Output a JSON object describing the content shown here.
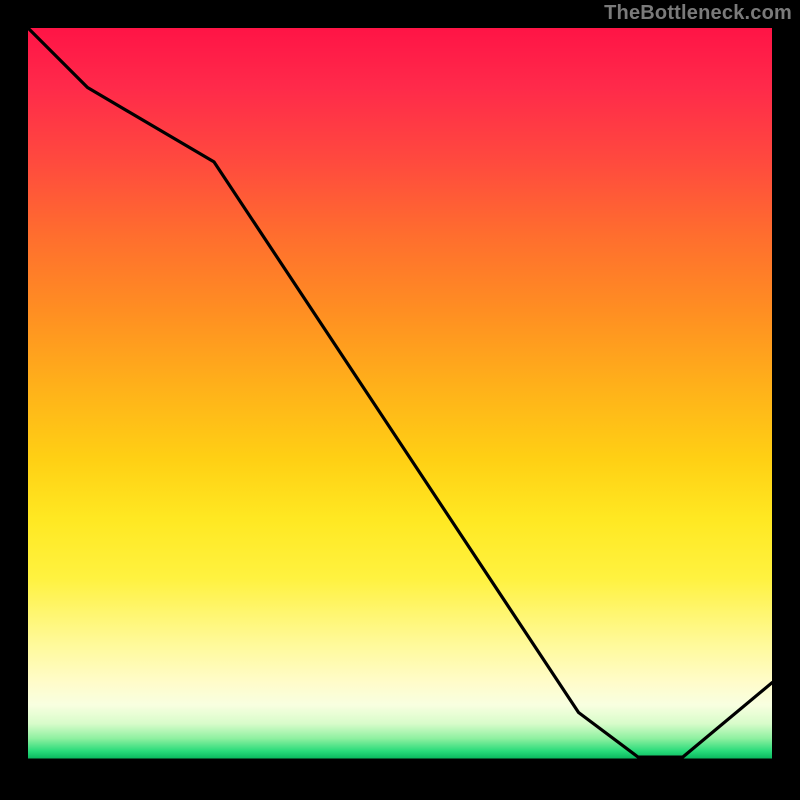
{
  "attribution": "TheBottleneck.com",
  "chart_data": {
    "type": "line",
    "title": "",
    "xlabel": "",
    "ylabel": "",
    "xlim": [
      0,
      100
    ],
    "ylim": [
      0,
      100
    ],
    "x": [
      0,
      8,
      25,
      74,
      82,
      88,
      100
    ],
    "values": [
      100,
      92,
      82,
      8,
      2,
      2,
      12
    ],
    "notes": "Black curve plotted over vertical red-to-green gradient; minimum plateau near x≈82–88 at y≈2.",
    "gradient_stops": [
      {
        "pos": 0.0,
        "color": "#ff1446"
      },
      {
        "pos": 0.38,
        "color": "#ff8e22"
      },
      {
        "pos": 0.66,
        "color": "#ffe822"
      },
      {
        "pos": 0.88,
        "color": "#fffcca"
      },
      {
        "pos": 0.972,
        "color": "#28db7a"
      },
      {
        "pos": 0.982,
        "color": "#000000"
      }
    ],
    "tick_label_text": "",
    "tick_label_position_x_frac": 0.8
  },
  "colors": {
    "curve": "#000000",
    "tick_label": "#b62a20",
    "attribution": "#7a7a7a",
    "frame": "#000000"
  }
}
